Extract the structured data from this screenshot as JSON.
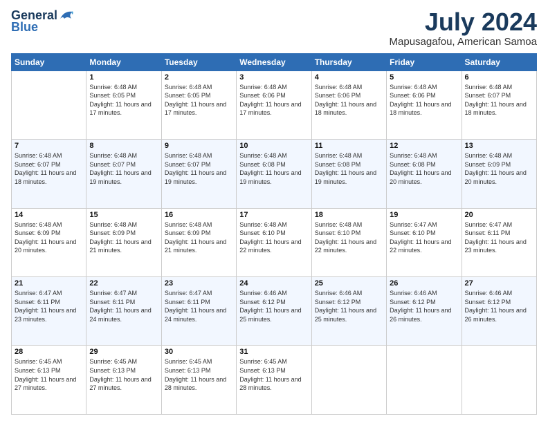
{
  "header": {
    "logo_general": "General",
    "logo_blue": "Blue",
    "month_title": "July 2024",
    "location": "Mapusagafou, American Samoa"
  },
  "weekdays": [
    "Sunday",
    "Monday",
    "Tuesday",
    "Wednesday",
    "Thursday",
    "Friday",
    "Saturday"
  ],
  "weeks": [
    [
      {
        "day": "",
        "sunrise": "",
        "sunset": "",
        "daylight": ""
      },
      {
        "day": "1",
        "sunrise": "Sunrise: 6:48 AM",
        "sunset": "Sunset: 6:05 PM",
        "daylight": "Daylight: 11 hours and 17 minutes."
      },
      {
        "day": "2",
        "sunrise": "Sunrise: 6:48 AM",
        "sunset": "Sunset: 6:05 PM",
        "daylight": "Daylight: 11 hours and 17 minutes."
      },
      {
        "day": "3",
        "sunrise": "Sunrise: 6:48 AM",
        "sunset": "Sunset: 6:06 PM",
        "daylight": "Daylight: 11 hours and 17 minutes."
      },
      {
        "day": "4",
        "sunrise": "Sunrise: 6:48 AM",
        "sunset": "Sunset: 6:06 PM",
        "daylight": "Daylight: 11 hours and 18 minutes."
      },
      {
        "day": "5",
        "sunrise": "Sunrise: 6:48 AM",
        "sunset": "Sunset: 6:06 PM",
        "daylight": "Daylight: 11 hours and 18 minutes."
      },
      {
        "day": "6",
        "sunrise": "Sunrise: 6:48 AM",
        "sunset": "Sunset: 6:07 PM",
        "daylight": "Daylight: 11 hours and 18 minutes."
      }
    ],
    [
      {
        "day": "7",
        "sunrise": "Sunrise: 6:48 AM",
        "sunset": "Sunset: 6:07 PM",
        "daylight": "Daylight: 11 hours and 18 minutes."
      },
      {
        "day": "8",
        "sunrise": "Sunrise: 6:48 AM",
        "sunset": "Sunset: 6:07 PM",
        "daylight": "Daylight: 11 hours and 19 minutes."
      },
      {
        "day": "9",
        "sunrise": "Sunrise: 6:48 AM",
        "sunset": "Sunset: 6:07 PM",
        "daylight": "Daylight: 11 hours and 19 minutes."
      },
      {
        "day": "10",
        "sunrise": "Sunrise: 6:48 AM",
        "sunset": "Sunset: 6:08 PM",
        "daylight": "Daylight: 11 hours and 19 minutes."
      },
      {
        "day": "11",
        "sunrise": "Sunrise: 6:48 AM",
        "sunset": "Sunset: 6:08 PM",
        "daylight": "Daylight: 11 hours and 19 minutes."
      },
      {
        "day": "12",
        "sunrise": "Sunrise: 6:48 AM",
        "sunset": "Sunset: 6:08 PM",
        "daylight": "Daylight: 11 hours and 20 minutes."
      },
      {
        "day": "13",
        "sunrise": "Sunrise: 6:48 AM",
        "sunset": "Sunset: 6:09 PM",
        "daylight": "Daylight: 11 hours and 20 minutes."
      }
    ],
    [
      {
        "day": "14",
        "sunrise": "Sunrise: 6:48 AM",
        "sunset": "Sunset: 6:09 PM",
        "daylight": "Daylight: 11 hours and 20 minutes."
      },
      {
        "day": "15",
        "sunrise": "Sunrise: 6:48 AM",
        "sunset": "Sunset: 6:09 PM",
        "daylight": "Daylight: 11 hours and 21 minutes."
      },
      {
        "day": "16",
        "sunrise": "Sunrise: 6:48 AM",
        "sunset": "Sunset: 6:09 PM",
        "daylight": "Daylight: 11 hours and 21 minutes."
      },
      {
        "day": "17",
        "sunrise": "Sunrise: 6:48 AM",
        "sunset": "Sunset: 6:10 PM",
        "daylight": "Daylight: 11 hours and 22 minutes."
      },
      {
        "day": "18",
        "sunrise": "Sunrise: 6:48 AM",
        "sunset": "Sunset: 6:10 PM",
        "daylight": "Daylight: 11 hours and 22 minutes."
      },
      {
        "day": "19",
        "sunrise": "Sunrise: 6:47 AM",
        "sunset": "Sunset: 6:10 PM",
        "daylight": "Daylight: 11 hours and 22 minutes."
      },
      {
        "day": "20",
        "sunrise": "Sunrise: 6:47 AM",
        "sunset": "Sunset: 6:11 PM",
        "daylight": "Daylight: 11 hours and 23 minutes."
      }
    ],
    [
      {
        "day": "21",
        "sunrise": "Sunrise: 6:47 AM",
        "sunset": "Sunset: 6:11 PM",
        "daylight": "Daylight: 11 hours and 23 minutes."
      },
      {
        "day": "22",
        "sunrise": "Sunrise: 6:47 AM",
        "sunset": "Sunset: 6:11 PM",
        "daylight": "Daylight: 11 hours and 24 minutes."
      },
      {
        "day": "23",
        "sunrise": "Sunrise: 6:47 AM",
        "sunset": "Sunset: 6:11 PM",
        "daylight": "Daylight: 11 hours and 24 minutes."
      },
      {
        "day": "24",
        "sunrise": "Sunrise: 6:46 AM",
        "sunset": "Sunset: 6:12 PM",
        "daylight": "Daylight: 11 hours and 25 minutes."
      },
      {
        "day": "25",
        "sunrise": "Sunrise: 6:46 AM",
        "sunset": "Sunset: 6:12 PM",
        "daylight": "Daylight: 11 hours and 25 minutes."
      },
      {
        "day": "26",
        "sunrise": "Sunrise: 6:46 AM",
        "sunset": "Sunset: 6:12 PM",
        "daylight": "Daylight: 11 hours and 26 minutes."
      },
      {
        "day": "27",
        "sunrise": "Sunrise: 6:46 AM",
        "sunset": "Sunset: 6:12 PM",
        "daylight": "Daylight: 11 hours and 26 minutes."
      }
    ],
    [
      {
        "day": "28",
        "sunrise": "Sunrise: 6:45 AM",
        "sunset": "Sunset: 6:13 PM",
        "daylight": "Daylight: 11 hours and 27 minutes."
      },
      {
        "day": "29",
        "sunrise": "Sunrise: 6:45 AM",
        "sunset": "Sunset: 6:13 PM",
        "daylight": "Daylight: 11 hours and 27 minutes."
      },
      {
        "day": "30",
        "sunrise": "Sunrise: 6:45 AM",
        "sunset": "Sunset: 6:13 PM",
        "daylight": "Daylight: 11 hours and 28 minutes."
      },
      {
        "day": "31",
        "sunrise": "Sunrise: 6:45 AM",
        "sunset": "Sunset: 6:13 PM",
        "daylight": "Daylight: 11 hours and 28 minutes."
      },
      {
        "day": "",
        "sunrise": "",
        "sunset": "",
        "daylight": ""
      },
      {
        "day": "",
        "sunrise": "",
        "sunset": "",
        "daylight": ""
      },
      {
        "day": "",
        "sunrise": "",
        "sunset": "",
        "daylight": ""
      }
    ]
  ]
}
